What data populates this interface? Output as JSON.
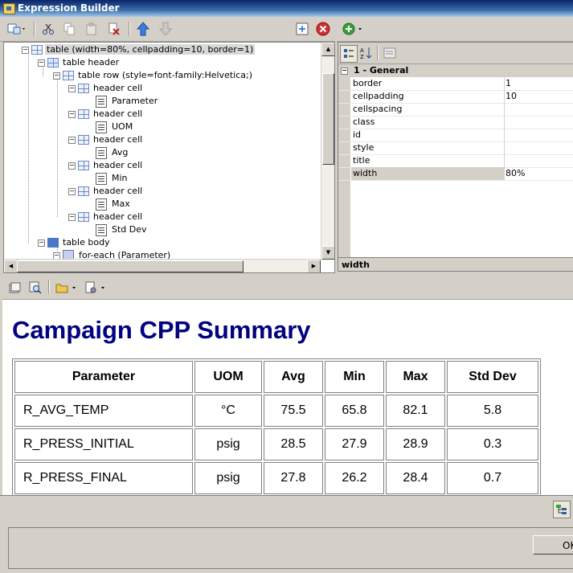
{
  "window": {
    "title": "Expression Builder"
  },
  "tree": {
    "nodes": [
      {
        "label": "table (width=80%, cellpadding=10, border=1)",
        "type": "table",
        "selected": true
      },
      {
        "label": "table header",
        "type": "header"
      },
      {
        "label": "table row (style=font-family:Helvetica;)",
        "type": "table"
      },
      {
        "label": "header cell",
        "type": "table"
      },
      {
        "label": "Parameter",
        "type": "text"
      },
      {
        "label": "header cell",
        "type": "table"
      },
      {
        "label": "UOM",
        "type": "text"
      },
      {
        "label": "header cell",
        "type": "table"
      },
      {
        "label": "Avg",
        "type": "text"
      },
      {
        "label": "header cell",
        "type": "table"
      },
      {
        "label": "Min",
        "type": "text"
      },
      {
        "label": "header cell",
        "type": "table"
      },
      {
        "label": "Max",
        "type": "text"
      },
      {
        "label": "header cell",
        "type": "table"
      },
      {
        "label": "Std Dev",
        "type": "text"
      },
      {
        "label": "table body",
        "type": "body"
      },
      {
        "label": "for-each (Parameter)",
        "type": "foreach"
      }
    ]
  },
  "properties": {
    "group": "1 - General",
    "rows": [
      {
        "name": "border",
        "value": "1"
      },
      {
        "name": "cellpadding",
        "value": "10"
      },
      {
        "name": "cellspacing",
        "value": ""
      },
      {
        "name": "class",
        "value": ""
      },
      {
        "name": "id",
        "value": ""
      },
      {
        "name": "style",
        "value": ""
      },
      {
        "name": "title",
        "value": ""
      },
      {
        "name": "width",
        "value": "80%"
      }
    ],
    "description": "width"
  },
  "preview": {
    "heading": "Campaign CPP Summary",
    "columns": [
      "Parameter",
      "UOM",
      "Avg",
      "Min",
      "Max",
      "Std Dev"
    ],
    "rows": [
      [
        "R_AVG_TEMP",
        "°C",
        "75.5",
        "65.8",
        "82.1",
        "5.8"
      ],
      [
        "R_PRESS_INITIAL",
        "psig",
        "28.5",
        "27.9",
        "28.9",
        "0.3"
      ],
      [
        "R_PRESS_FINAL",
        "psig",
        "27.8",
        "26.2",
        "28.4",
        "0.7"
      ]
    ]
  },
  "buttons": {
    "ok": "OK"
  },
  "colors": {
    "heading": "#000080",
    "titlebar": "#0a246a"
  }
}
